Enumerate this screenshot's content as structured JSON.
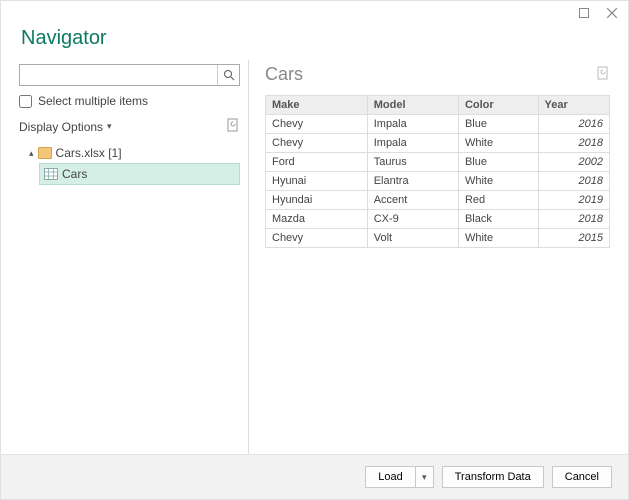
{
  "window": {
    "title": "Navigator"
  },
  "left": {
    "search_placeholder": "",
    "select_multiple": "Select multiple items",
    "display_options": "Display Options",
    "tree": {
      "root_label": "Cars.xlsx [1]",
      "leaf_label": "Cars"
    }
  },
  "right": {
    "title": "Cars",
    "table": {
      "columns": [
        "Make",
        "Model",
        "Color",
        "Year"
      ],
      "rows": [
        [
          "Chevy",
          "Impala",
          "Blue",
          "2016"
        ],
        [
          "Chevy",
          "Impala",
          "White",
          "2018"
        ],
        [
          "Ford",
          "Taurus",
          "Blue",
          "2002"
        ],
        [
          "Hyunai",
          "Elantra",
          "White",
          "2018"
        ],
        [
          "Hyundai",
          "Accent",
          "Red",
          "2019"
        ],
        [
          "Mazda",
          "CX-9",
          "Black",
          "2018"
        ],
        [
          "Chevy",
          "Volt",
          "White",
          "2015"
        ]
      ]
    }
  },
  "footer": {
    "load": "Load",
    "transform": "Transform Data",
    "cancel": "Cancel"
  }
}
